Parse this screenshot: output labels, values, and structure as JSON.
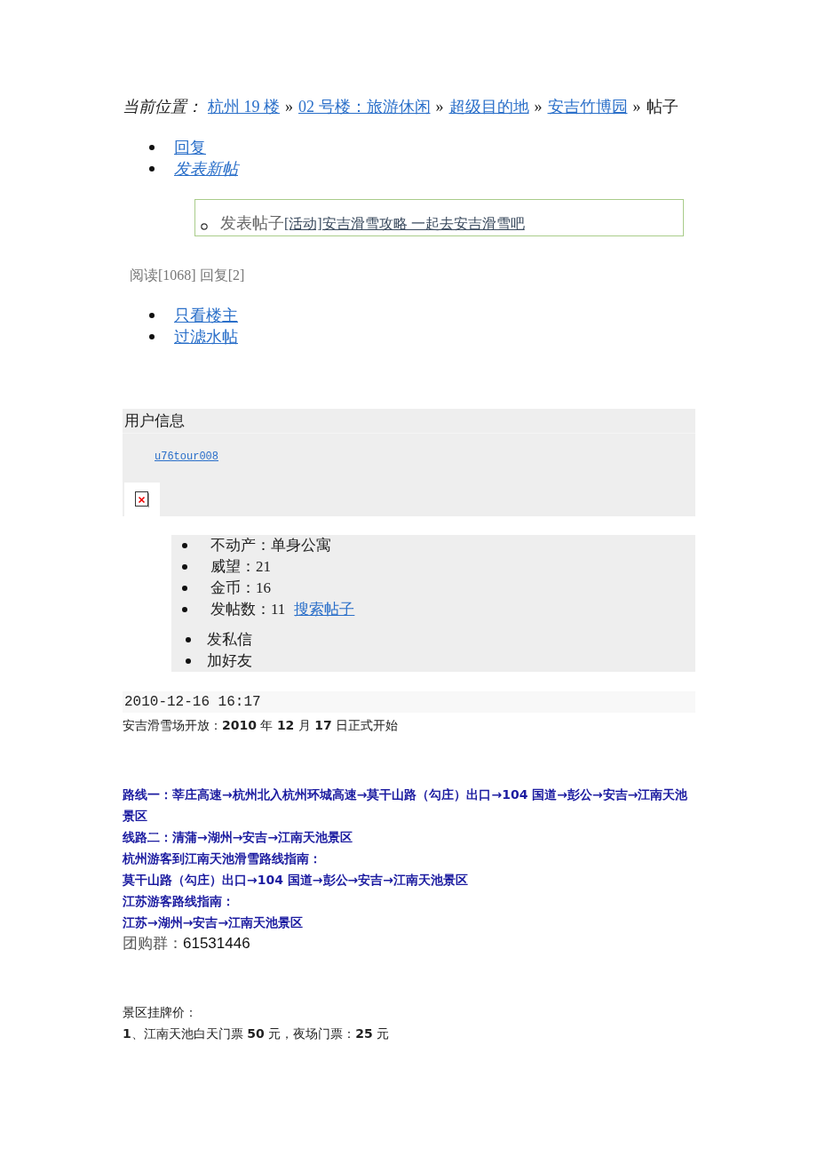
{
  "breadcrumb": {
    "label": "当前位置：",
    "items": [
      {
        "text": "杭州 19 楼",
        "link": true
      },
      {
        "text": "»",
        "link": false
      },
      {
        "text": "02 号楼：旅游休闲",
        "link": true
      },
      {
        "text": "»",
        "link": false
      },
      {
        "text": "超级目的地",
        "link": true
      },
      {
        "text": "»",
        "link": false
      },
      {
        "text": "安吉竹博园",
        "link": true
      },
      {
        "text": "»",
        "link": false
      },
      {
        "text": "帖子",
        "link": false
      }
    ]
  },
  "actions": [
    {
      "label": "回复",
      "italic": false
    },
    {
      "label": "发表新帖",
      "italic": true
    }
  ],
  "thread_box": {
    "prefix": "发表帖子",
    "title": "[活动]安吉滑雪攻略 一起去安吉滑雪吧"
  },
  "stats": "阅读[1068] 回复[2]",
  "filters": [
    "只看楼主",
    "过滤水帖"
  ],
  "user_info": {
    "heading": "用户信息",
    "username": "u76tour008"
  },
  "profile": {
    "items": [
      {
        "text": "不动产：单身公寓"
      },
      {
        "text": "威望：21"
      },
      {
        "text": "金币：16"
      },
      {
        "text": "发帖数：11",
        "link": "搜索帖子"
      }
    ],
    "actions": [
      "发私信",
      "加好友"
    ]
  },
  "post": {
    "time": "2010-12-16 16:17",
    "headline": "安吉滑雪场开放：**2010** 年 **12** 月 **17** 日正式开始",
    "routes": [
      "路线一：莘庄高速→杭州北入杭州环城高速→莫干山路（勾庄）出口→104 国道→彭公→安吉→江南天池景区",
      "线路二：清蒲→湖州→安吉→江南天池景区",
      "杭州游客到江南天池滑雪路线指南：",
      "莫干山路（勾庄）出口→104 国道→彭公→安吉→江南天池景区",
      "江苏游客路线指南：",
      "江苏→湖州→安吉→江南天池景区"
    ],
    "group_buy": {
      "label": "团购群：",
      "value": "61531446"
    },
    "price_heading": "景区挂牌价：",
    "prices": [
      "**1**、江南天池白天门票 **50** 元，夜场门票：**25** 元"
    ]
  }
}
